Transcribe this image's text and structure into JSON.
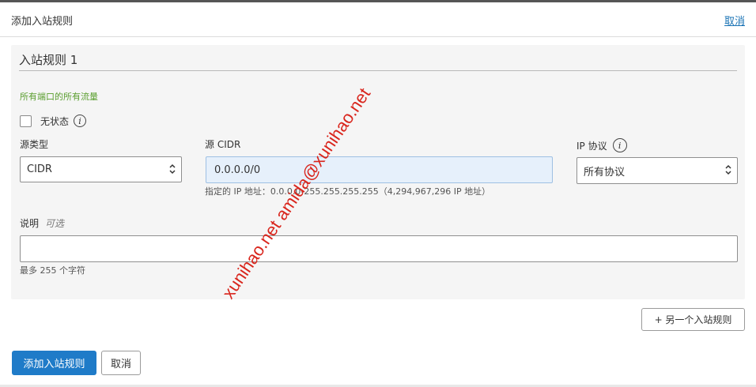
{
  "header": {
    "title": "添加入站规则",
    "cancel_link": "取消"
  },
  "rule": {
    "title": "入站规则 1",
    "traffic_note": "所有端口的所有流量",
    "stateless_label": "无状态",
    "info_glyph": "i",
    "source_type": {
      "label": "源类型",
      "value": "CIDR"
    },
    "source_cidr": {
      "label": "源 CIDR",
      "value": "0.0.0.0/0",
      "hint": "指定的 IP 地址：0.0.0.0-255.255.255.255（4,294,967,296 IP 地址）"
    },
    "ip_protocol": {
      "label": "IP 协议",
      "value": "所有协议"
    },
    "description": {
      "label": "说明",
      "optional": "可选",
      "value": "",
      "hint": "最多 255 个字符"
    }
  },
  "actions": {
    "add_another": "+ 另一个入站规则",
    "submit": "添加入站规则",
    "cancel": "取消"
  },
  "watermark": "xunihao.net amida@xunihao.net",
  "colors": {
    "primary": "#1f7bc8",
    "link": "#1a73b5",
    "note_green": "#5a9e2f",
    "watermark_red": "#d9251c",
    "cidr_bg": "#e6f0fb"
  },
  "icons": {
    "info": "info-icon",
    "select_chevron": "chevron-up-down-icon"
  }
}
